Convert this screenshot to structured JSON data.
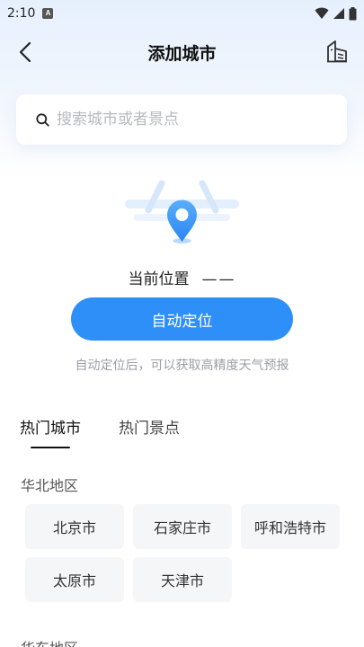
{
  "status_bar": {
    "time": "2:10",
    "notification_letter": "A"
  },
  "nav": {
    "title": "添加城市"
  },
  "search": {
    "placeholder": "搜索城市或者景点",
    "value": ""
  },
  "location": {
    "current_label": "当前位置",
    "current_value": "——",
    "auto_button": "自动定位",
    "hint": "自动定位后，可以获取高精度天气预报"
  },
  "tabs": [
    {
      "label": "热门城市",
      "active": true
    },
    {
      "label": "热门景点",
      "active": false
    }
  ],
  "regions": [
    {
      "title": "华北地区",
      "cities": [
        "北京市",
        "石家庄市",
        "呼和浩特市",
        "太原市",
        "天津市"
      ]
    },
    {
      "title": "华东地区",
      "cities": []
    }
  ],
  "colors": {
    "accent": "#2f8ff8",
    "chip_bg": "#f5f6f8"
  }
}
